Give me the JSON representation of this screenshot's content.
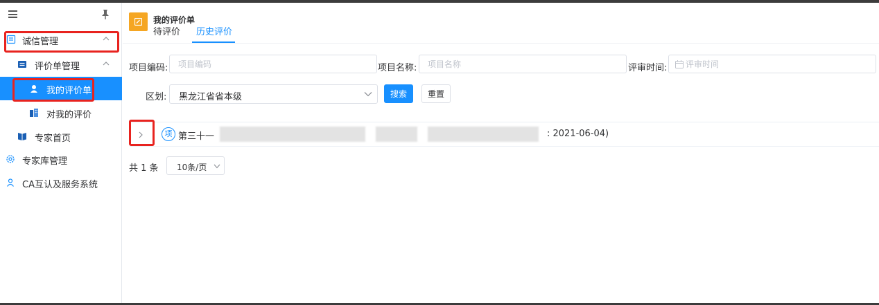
{
  "sidebar": {
    "items": [
      {
        "label": "诚信管理"
      },
      {
        "label": "评价单管理"
      },
      {
        "label": "我的评价单"
      },
      {
        "label": "对我的评价"
      },
      {
        "label": "专家首页"
      },
      {
        "label": "专家库管理"
      },
      {
        "label": "CA互认及服务系统"
      }
    ]
  },
  "header": {
    "title": "我的评价单",
    "tabs": [
      {
        "label": "待评价"
      },
      {
        "label": "历史评价"
      }
    ]
  },
  "filters": {
    "code_label": "项目编码:",
    "code_placeholder": "项目编码",
    "name_label": "项目名称:",
    "name_placeholder": "项目名称",
    "time_label": "评审时间:",
    "time_placeholder": "评审时间",
    "region_label": "区划:",
    "region_value": "黑龙江省省本级",
    "search_label": "搜索",
    "reset_label": "重置"
  },
  "list": {
    "rows": [
      {
        "badge": "项",
        "text_start": "第三十一",
        "text_end": ": 2021-06-04)"
      }
    ]
  },
  "pagination": {
    "total": "共 1 条",
    "page_size": "10条/页"
  },
  "colors": {
    "primary": "#1890ff",
    "highlight": "#e8231f",
    "logo": "#f5a623"
  }
}
